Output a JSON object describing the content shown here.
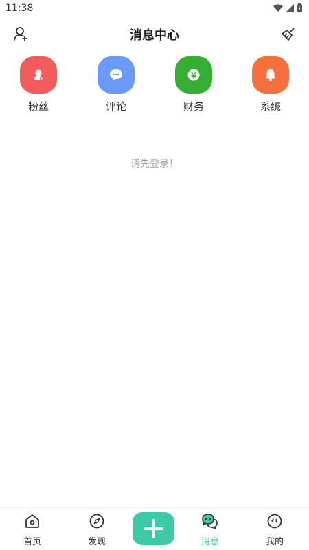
{
  "status_bar": {
    "time": "11:38"
  },
  "header": {
    "title": "消息中心"
  },
  "quick_actions": [
    {
      "label": "粉丝",
      "color": "#f25c5c",
      "icon": "fans-icon"
    },
    {
      "label": "评论",
      "color": "#6b99f7",
      "icon": "comment-icon"
    },
    {
      "label": "财务",
      "color": "#34ae33",
      "icon": "finance-yen-icon"
    },
    {
      "label": "系统",
      "color": "#f5703c",
      "icon": "bell-icon"
    }
  ],
  "empty_message": "请先登录！",
  "tabbar": {
    "items": [
      {
        "label": "首页",
        "icon": "home-icon"
      },
      {
        "label": "发现",
        "icon": "compass-icon"
      },
      {
        "label": "消息",
        "icon": "chat-bubble-icon",
        "active": true
      },
      {
        "label": "我的",
        "icon": "profile-face-icon"
      }
    ],
    "accent_color": "#3ec9a7"
  }
}
